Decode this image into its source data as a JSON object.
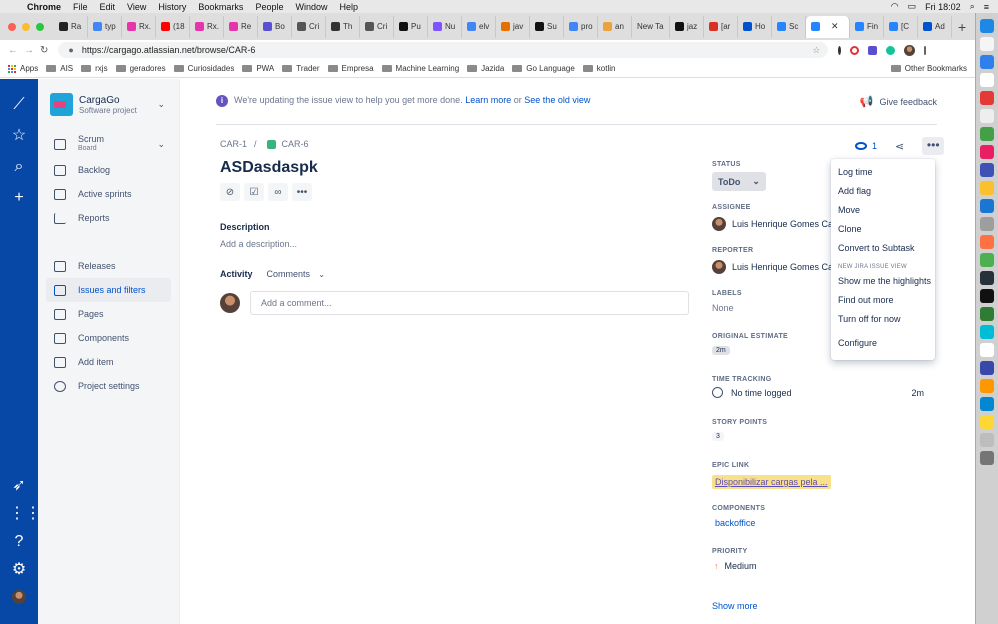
{
  "macbar": {
    "app": "Chrome",
    "menus": [
      "File",
      "Edit",
      "View",
      "History",
      "Bookmarks",
      "People",
      "Window",
      "Help"
    ],
    "clock": "Fri 18:02"
  },
  "browser": {
    "tabs": [
      "Ra",
      "typ",
      "Rx.",
      "(18",
      "Rx.",
      "Re",
      "Bo",
      "Cri",
      "Th",
      "Cri",
      "Pu",
      "Nu",
      "elv",
      "jav",
      "Su",
      "pro",
      "an",
      "New Ta",
      "jaz",
      "[ar",
      "Ho",
      "Sc",
      "",
      "Fin",
      "[C",
      "Ad"
    ],
    "url": "https://cargago.atlassian.net/browse/CAR-6",
    "bookmarks": [
      "Apps",
      "AIS",
      "rxjs",
      "geradores",
      "Curiosidades",
      "PWA",
      "Trader",
      "Empresa",
      "Machine Learning",
      "Jazida",
      "Go Language",
      "kotlin"
    ],
    "other_bookmarks": "Other Bookmarks"
  },
  "project": {
    "name": "CargaGo",
    "type": "Software project"
  },
  "sidebar": {
    "board": {
      "label": "Scrum",
      "sub": "Board"
    },
    "items": [
      "Backlog",
      "Active sprints",
      "Reports"
    ],
    "items2": [
      "Releases",
      "Issues and filters",
      "Pages",
      "Components",
      "Add item",
      "Project settings"
    ]
  },
  "banner": {
    "text": "We're updating the issue view to help you get more done.",
    "learn": "Learn more",
    "or": "or",
    "old": "See the old view",
    "feedback": "Give feedback"
  },
  "issue": {
    "parent": "CAR-1",
    "sep": "/",
    "key": "CAR-6",
    "title": "ASDasdaspk",
    "description_label": "Description",
    "description_placeholder": "Add a description...",
    "activity_label": "Activity",
    "activity_filter": "Comments",
    "comment_placeholder": "Add a comment...",
    "watchers": "1"
  },
  "fields": {
    "status_label": "STATUS",
    "status": "ToDo",
    "assignee_label": "ASSIGNEE",
    "assignee": "Luis Henrique Gomes Car",
    "reporter_label": "REPORTER",
    "reporter": "Luis Henrique Gomes Car",
    "labels_label": "LABELS",
    "labels": "None",
    "estimate_label": "ORIGINAL ESTIMATE",
    "estimate": "2m",
    "tracking_label": "TIME TRACKING",
    "tracking": "No time logged",
    "tracking_right": "2m",
    "points_label": "STORY POINTS",
    "points": "3",
    "epic_label": "EPIC LINK",
    "epic": "Disponibilizar cargas pela ...",
    "components_label": "COMPONENTS",
    "components": "backoffice",
    "priority_label": "PRIORITY",
    "priority": "Medium",
    "show_more": "Show more"
  },
  "menu": {
    "items": [
      "Log time",
      "Add flag",
      "Move",
      "Clone",
      "Convert to Subtask"
    ],
    "header": "NEW JIRA ISSUE VIEW",
    "items2": [
      "Show me the highlights",
      "Find out more",
      "Turn off for now"
    ],
    "configure": "Configure"
  },
  "colors": {
    "global_nav": "#0747A6",
    "link": "#0052CC",
    "epic": "#F9E08B"
  }
}
